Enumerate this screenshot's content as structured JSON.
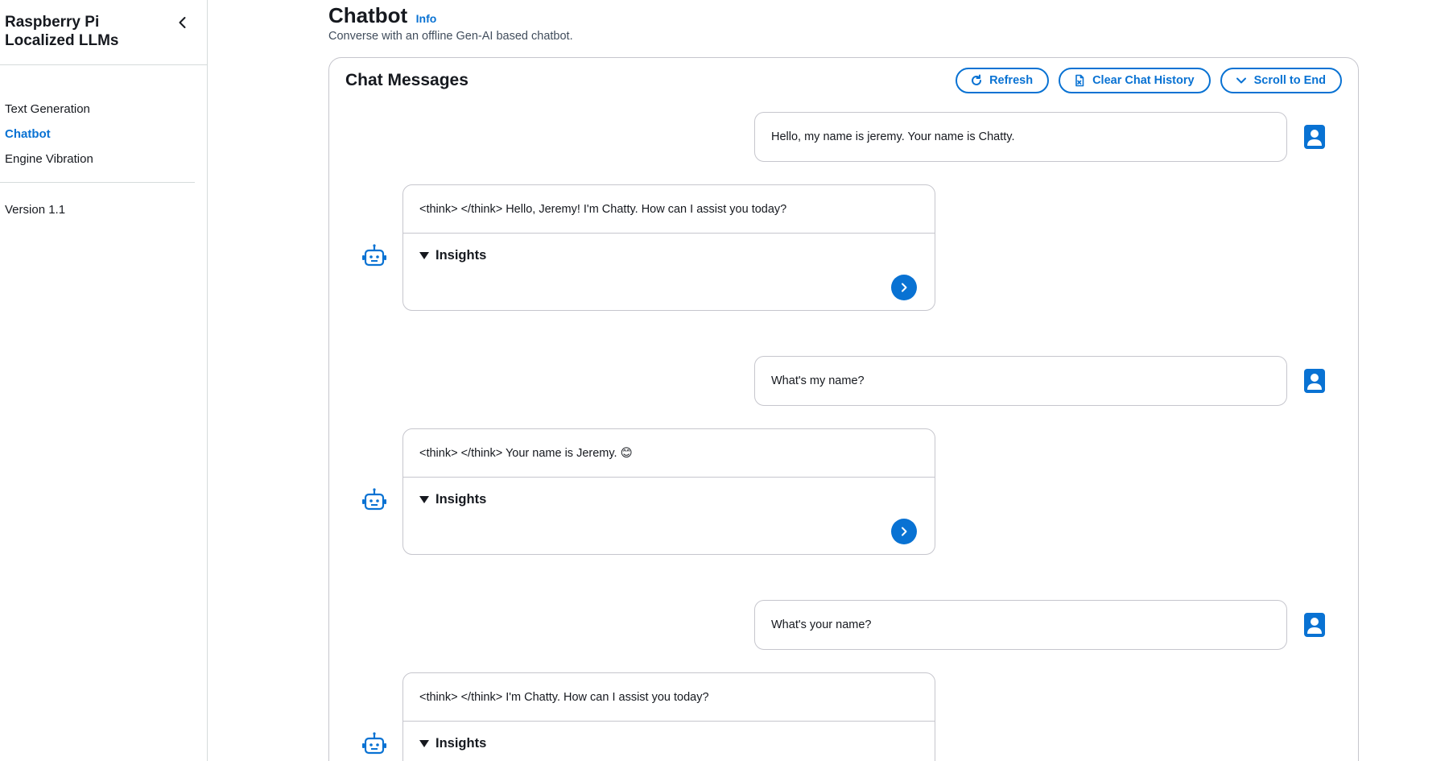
{
  "sidebar": {
    "title": "Raspberry Pi Localized LLMs",
    "items": [
      {
        "label": "Text Generation",
        "active": false
      },
      {
        "label": "Chatbot",
        "active": true
      },
      {
        "label": "Engine Vibration",
        "active": false
      }
    ],
    "version": "Version 1.1"
  },
  "header": {
    "title": "Chatbot",
    "info": "Info",
    "description": "Converse with an offline Gen-AI based chatbot."
  },
  "chat": {
    "title": "Chat Messages",
    "buttons": {
      "refresh": "Refresh",
      "clear": "Clear Chat History",
      "scroll": "Scroll to End"
    },
    "messages": [
      {
        "role": "user",
        "text": "Hello, my name is jeremy. Your name is Chatty."
      },
      {
        "role": "bot",
        "text": "<think> </think> Hello, Jeremy! I'm Chatty. How can I assist you today?",
        "insights": "Insights"
      },
      {
        "role": "user",
        "text": "What's my name?"
      },
      {
        "role": "bot",
        "text": "<think> </think> Your name is Jeremy. 😊",
        "insights": "Insights"
      },
      {
        "role": "user",
        "text": "What's your name?"
      },
      {
        "role": "bot",
        "text": "<think> </think> I'm Chatty. How can I assist you today?",
        "insights": "Insights"
      }
    ]
  },
  "colors": {
    "accent": "#0972d3",
    "border": "#c6c6cd",
    "text": "#16191f"
  },
  "icons": {
    "collapse": "chevron-left-icon",
    "refresh": "refresh-icon",
    "clear": "file-clear-icon",
    "scroll": "chevron-down-icon",
    "user": "user-profile-icon",
    "bot": "robot-icon",
    "next": "chevron-right-icon"
  }
}
